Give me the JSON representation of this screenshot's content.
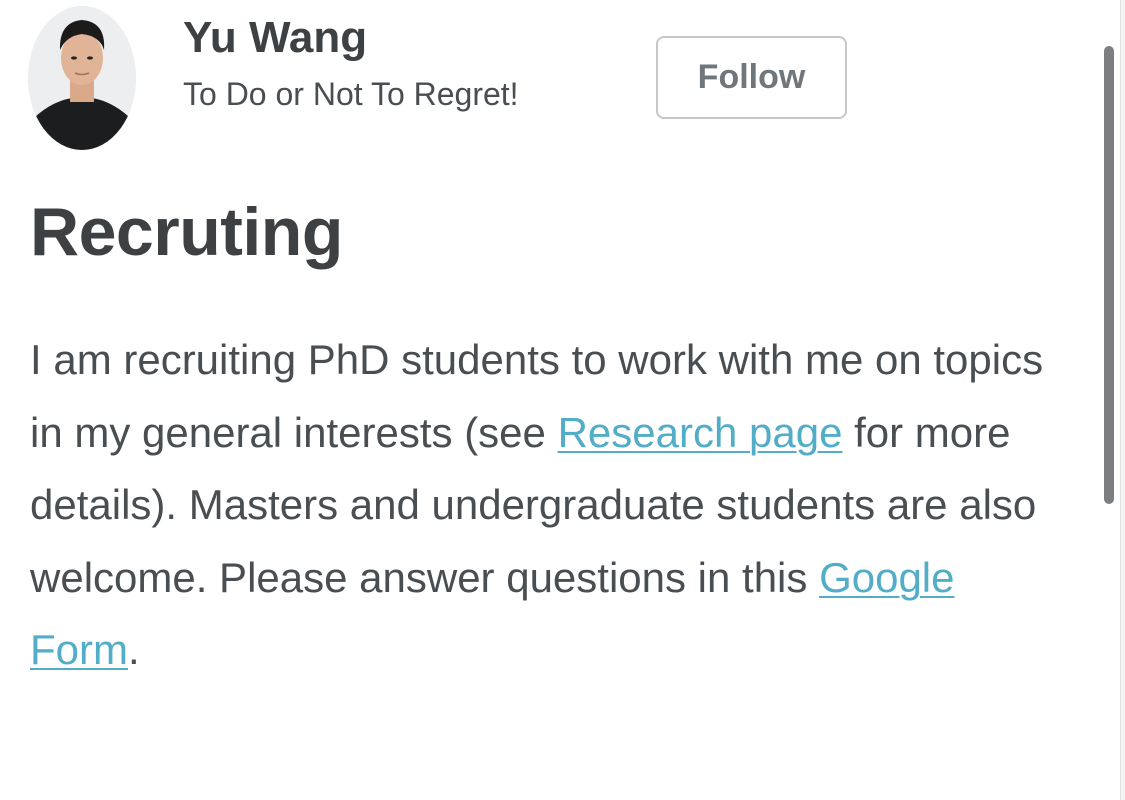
{
  "author": {
    "name": "Yu Wang",
    "bio": "To Do or Not To Regret!",
    "follow_label": "Follow"
  },
  "article": {
    "title": "Recruting",
    "paragraph": {
      "text_1": "I am recruiting PhD students to work with me on topics in my general interests (see ",
      "link_research": "Research page",
      "text_2": " for more details). Masters and undergraduate students are also welcome. Please answer questions in this ",
      "link_form": "Google Form",
      "text_3": "."
    }
  },
  "colors": {
    "link": "#52adc8",
    "heading": "#3d4144",
    "body_text": "#494e52",
    "button_border": "#c4c8cb"
  }
}
